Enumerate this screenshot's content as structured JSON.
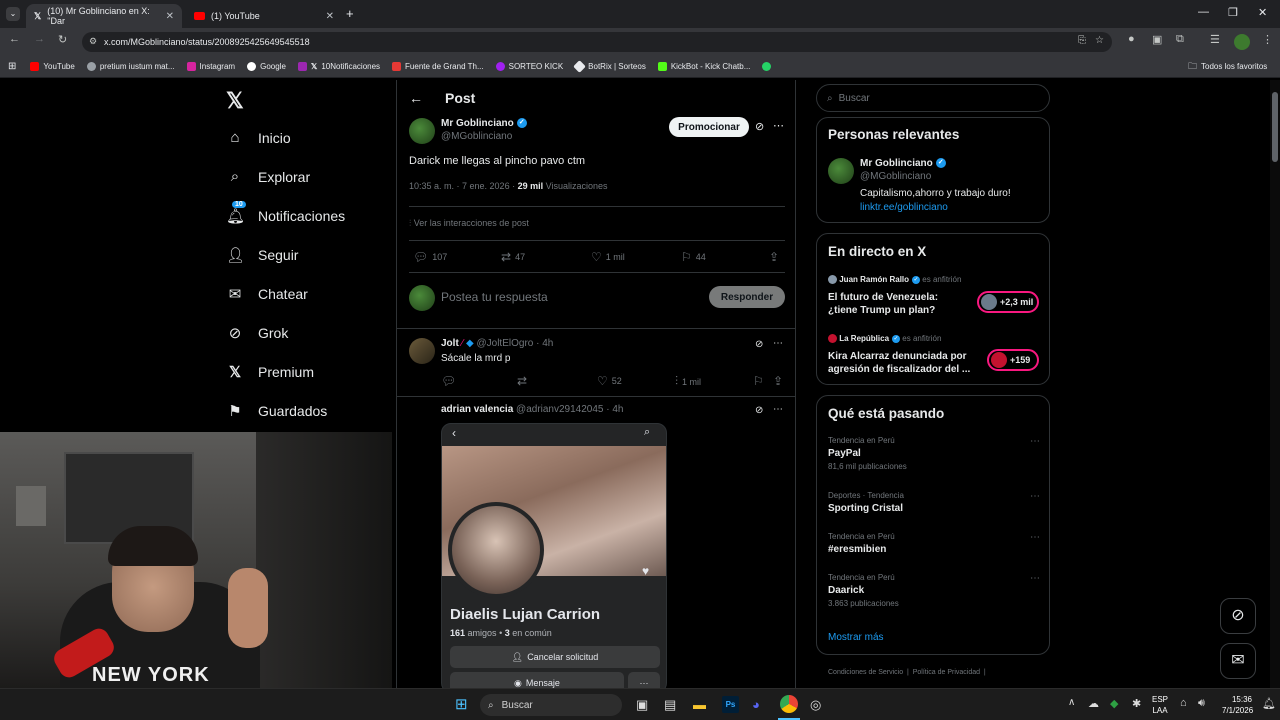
{
  "browser": {
    "tabs": [
      {
        "title": "(10) Mr Goblinciano en X: \"Dar"
      },
      {
        "title": "(1) YouTube"
      }
    ],
    "url": "x.com/MGoblinciano/status/2008925425649545518",
    "bookmarks": [
      "YouTube",
      "pretium iustum mat...",
      "Instagram",
      "Google",
      "10Notificaciones",
      "Fuente de Grand Th...",
      "SORTEO KICK",
      "BotRix | Sorteos",
      "KickBot - Kick Chatb..."
    ],
    "all_bookmarks": "Todos los favoritos"
  },
  "nav": {
    "items": [
      "Inicio",
      "Explorar",
      "Notificaciones",
      "Seguir",
      "Chatear",
      "Grok",
      "Premium",
      "Guardados"
    ],
    "notif_badge": "10"
  },
  "post": {
    "header": "Post",
    "author_name": "Mr Goblinciano",
    "author_handle": "@MGoblinciano",
    "promote_label": "Promocionar",
    "text": "Darick me llegas al pincho pavo ctm",
    "timestamp": "10:35 a. m. · 7 ene. 2026 · ",
    "views_count": "29 mil",
    "views_label": "Visualizaciones",
    "interactions_link": "Ver las interacciones de post",
    "replies": "107",
    "reposts": "47",
    "likes": "1 mil",
    "bookmarks": "44",
    "reply_placeholder": "Postea tu respuesta",
    "reply_button": "Responder"
  },
  "replies": [
    {
      "name": "Jolt",
      "handle": "@JoltElOgro · 4h",
      "text": "Sácale la mrd p",
      "likes": "52",
      "views": "1 mil"
    },
    {
      "name": "adrian valencia",
      "handle": "@adrianv29142045 · 4h"
    }
  ],
  "embedded_profile": {
    "name": "Diaelis Lujan Carrion",
    "friends_count": "161",
    "friends_label": "amigos",
    "common_count": "3",
    "common_label": "en común",
    "cancel_label": "Cancelar solicitud",
    "message_label": "Mensaje"
  },
  "sidebar": {
    "search_placeholder": "Buscar",
    "relevant": {
      "title": "Personas relevantes",
      "name": "Mr Goblinciano",
      "handle": "@MGoblinciano",
      "bio": "Capitalismo,ahorro y trabajo duro!",
      "link": "linktr.ee/goblinciano"
    },
    "live": {
      "title": "En directo en X",
      "items": [
        {
          "host": "Juan Ramón Rallo",
          "role": "es anfitrión",
          "title": "El futuro de Venezuela: ¿tiene Trump un plan?",
          "listeners": "+2,3 mil"
        },
        {
          "host": "La República",
          "role": "es anfitrión",
          "title": "Kira Alcarraz denunciada por agresión de fiscalizador del ...",
          "listeners": "+159"
        }
      ]
    },
    "trends": {
      "title": "Qué está pasando",
      "items": [
        {
          "category": "Tendencia en Perú",
          "name": "PayPal",
          "count": "81,6 mil publicaciones"
        },
        {
          "category": "Deportes · Tendencia",
          "name": "Sporting Cristal",
          "count": ""
        },
        {
          "category": "Tendencia en Perú",
          "name": "#eresmibien",
          "count": ""
        },
        {
          "category": "Tendencia en Perú",
          "name": "Daarick",
          "count": "3.863 publicaciones"
        }
      ],
      "show_more": "Mostrar más"
    },
    "footer": [
      "Condiciones de Servicio",
      "Política de Privacidad"
    ]
  },
  "taskbar": {
    "search": "Buscar",
    "lang": "ESP",
    "lang2": "LAA",
    "time": "15:36",
    "date": "7/1/2026"
  },
  "webcam": {
    "shirt_text": "NEW YORK"
  },
  "colors": {
    "accent": "#1d9bf0",
    "background": "#000000",
    "border": "#2f3336",
    "muted": "#71767b",
    "live_pink": "#f91880"
  }
}
